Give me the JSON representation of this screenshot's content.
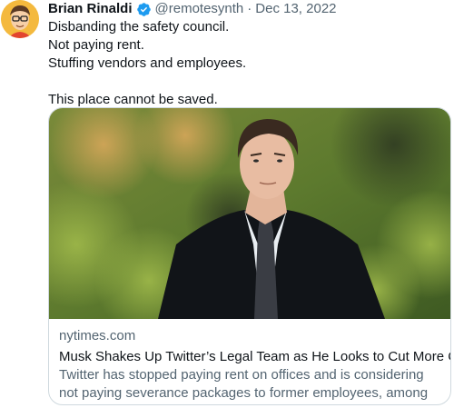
{
  "tweet": {
    "author_name": "Brian Rinaldi",
    "handle": "@remotesynth",
    "separator": "·",
    "date": "Dec 13, 2022",
    "lines": [
      "Disbanding the safety council.",
      "Not paying rent.",
      "Stuffing vendors and employees.",
      "This place cannot be saved."
    ]
  },
  "card": {
    "domain": "nytimes.com",
    "title": "Musk Shakes Up Twitter’s Legal Team as He Looks to Cut More Costs",
    "description": "Twitter has stopped paying rent on offices and is considering not paying severance packages to former employees, among other ..."
  },
  "colors": {
    "verified_blue": "#1d9bf0",
    "secondary_text": "#536471",
    "border": "#cfd9de"
  }
}
